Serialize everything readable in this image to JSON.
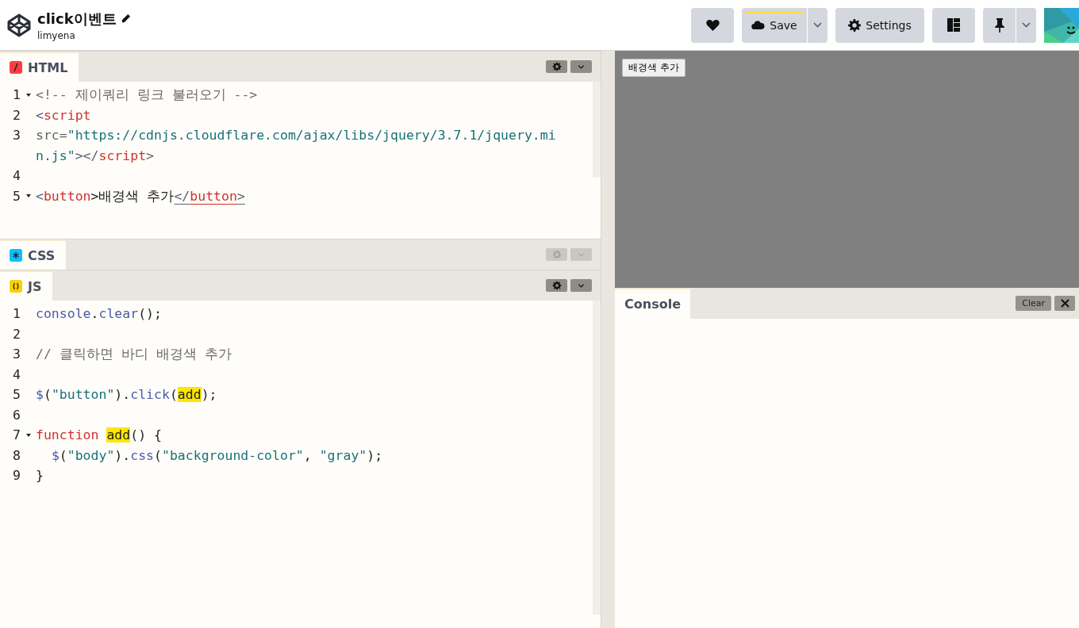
{
  "header": {
    "title": "click이벤트",
    "author": "limyena",
    "save": {
      "label": "Save",
      "unsaved": true
    },
    "settings": {
      "label": "Settings"
    }
  },
  "editors": [
    {
      "label": "HTML",
      "kind": "html",
      "color": "#ff3c41",
      "collapsed": false,
      "lines": [
        {
          "number": "1",
          "foldable": true,
          "tokens": [
            {
              "text": "<!-- 제이쿼리 링크 불러오기 -->",
              "kind": "comment"
            }
          ]
        },
        {
          "number": "2",
          "foldable": false,
          "tokens": [
            {
              "text": "<",
              "kind": "punct"
            },
            {
              "text": "script",
              "kind": "tag"
            }
          ]
        },
        {
          "number": "3",
          "foldable": false,
          "tokens": [
            {
              "text": "src=",
              "kind": "punct"
            },
            {
              "text": "\"https://cdnjs.cloudflare.com/ajax/libs/jquery/3.7.1/jquery.min.js\"",
              "kind": "string"
            },
            {
              "text": "></",
              "kind": "punct"
            },
            {
              "text": "script",
              "kind": "tag"
            },
            {
              "text": ">",
              "kind": "punct"
            }
          ]
        },
        {
          "number": "4",
          "foldable": false
        },
        {
          "number": "5",
          "foldable": true,
          "tokens": [
            {
              "text": "<",
              "kind": "punct"
            },
            {
              "text": "button",
              "kind": "tag"
            },
            {
              "text": ">배경색 추가",
              "kind": "plain"
            },
            {
              "text": "</",
              "kind": "match-punct"
            },
            {
              "text": "button",
              "kind": "match-tag"
            },
            {
              "text": ">",
              "kind": "match-punct"
            }
          ]
        }
      ]
    },
    {
      "label": "CSS",
      "kind": "css",
      "color": "#0ebeff",
      "collapsed": true
    },
    {
      "label": "JS",
      "kind": "js",
      "color": "#fcd000",
      "collapsed": false,
      "lines": [
        {
          "number": "1",
          "foldable": false,
          "tokens": [
            {
              "text": "console",
              "kind": "var"
            },
            {
              "text": ".",
              "kind": "plain"
            },
            {
              "text": "clear",
              "kind": "var"
            },
            {
              "text": "();",
              "kind": "plain"
            }
          ]
        },
        {
          "number": "2",
          "foldable": false
        },
        {
          "number": "3",
          "foldable": false,
          "tokens": [
            {
              "text": "// 클릭하면 바디 배경색 추가",
              "kind": "comment"
            }
          ]
        },
        {
          "number": "4",
          "foldable": false
        },
        {
          "number": "5",
          "foldable": false,
          "tokens": [
            {
              "text": "$",
              "kind": "var"
            },
            {
              "text": "(",
              "kind": "plain"
            },
            {
              "text": "\"button\"",
              "kind": "string"
            },
            {
              "text": ").",
              "kind": "plain"
            },
            {
              "text": "click",
              "kind": "var"
            },
            {
              "text": "(",
              "kind": "plain"
            },
            {
              "text": "add",
              "kind": "highlight"
            },
            {
              "text": ");",
              "kind": "plain"
            }
          ]
        },
        {
          "number": "6",
          "foldable": false
        },
        {
          "number": "7",
          "foldable": true,
          "tokens": [
            {
              "text": "function ",
              "kind": "keyword"
            },
            {
              "text": "add",
              "kind": "highlight"
            },
            {
              "text": "() {",
              "kind": "plain"
            }
          ]
        },
        {
          "number": "8",
          "foldable": false,
          "tokens": [
            {
              "text": "  $",
              "kind": "var"
            },
            {
              "text": "(",
              "kind": "plain"
            },
            {
              "text": "\"body\"",
              "kind": "string"
            },
            {
              "text": ").",
              "kind": "plain"
            },
            {
              "text": "css",
              "kind": "var"
            },
            {
              "text": "(",
              "kind": "plain"
            },
            {
              "text": "\"background-color\"",
              "kind": "string"
            },
            {
              "text": ", ",
              "kind": "plain"
            },
            {
              "text": "\"gray\"",
              "kind": "string"
            },
            {
              "text": ");",
              "kind": "plain"
            }
          ]
        },
        {
          "number": "9",
          "foldable": false,
          "tokens": [
            {
              "text": "}",
              "kind": "plain"
            }
          ]
        }
      ]
    }
  ],
  "preview": {
    "button": "배경색 추가"
  },
  "console": {
    "tab": "Console",
    "clear": "Clear"
  }
}
